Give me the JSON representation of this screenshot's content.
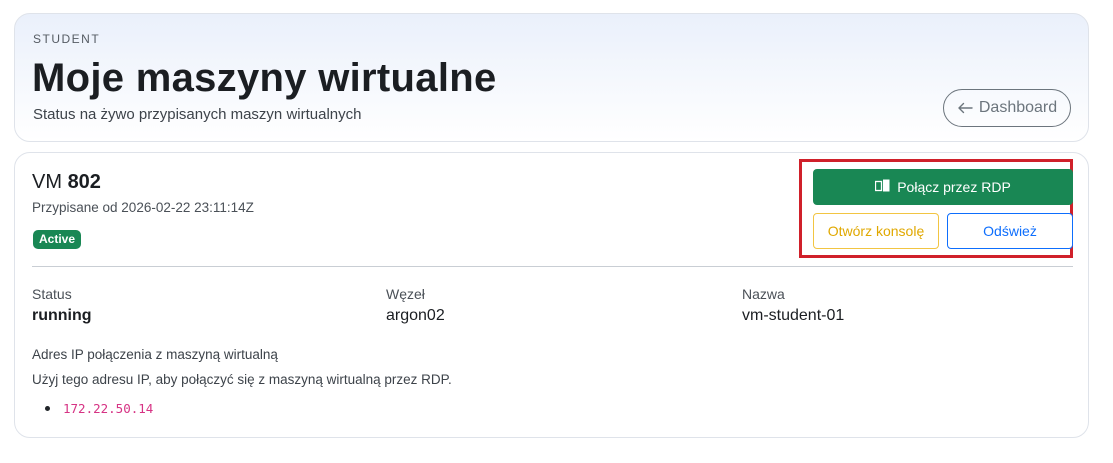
{
  "header": {
    "eyebrow": "STUDENT",
    "title": "Moje maszyny wirtualne",
    "subtitle": "Status na żywo przypisanych maszyn wirtualnych",
    "dashboard_label": "Dashboard",
    "dashboard_icon": "arrow-left-icon"
  },
  "vm": {
    "prefix": "VM",
    "id": "802",
    "assigned": "Przypisane od 2026-02-22 23:11:14Z",
    "badge": "Active",
    "actions": {
      "rdp_label": "Połącz przez RDP",
      "rdp_icon": "windows-icon",
      "console_label": "Otwórz konsolę",
      "refresh_label": "Odśwież"
    },
    "fields": [
      {
        "label": "Status",
        "value": "running"
      },
      {
        "label": "Węzeł",
        "value": "argon02"
      },
      {
        "label": "Nazwa",
        "value": "vm-student-01"
      }
    ],
    "ip_section": {
      "heading": "Adres IP połączenia z maszyną wirtualną",
      "hint": "Użyj tego adresu IP, aby połączyć się z maszyną wirtualną przez RDP.",
      "addresses": [
        "172.22.50.14"
      ]
    }
  },
  "colors": {
    "accent_green": "#198754",
    "warning": "#f2c542",
    "primary": "#0d6efd",
    "highlight": "#d0202a",
    "code": "#d63384"
  }
}
